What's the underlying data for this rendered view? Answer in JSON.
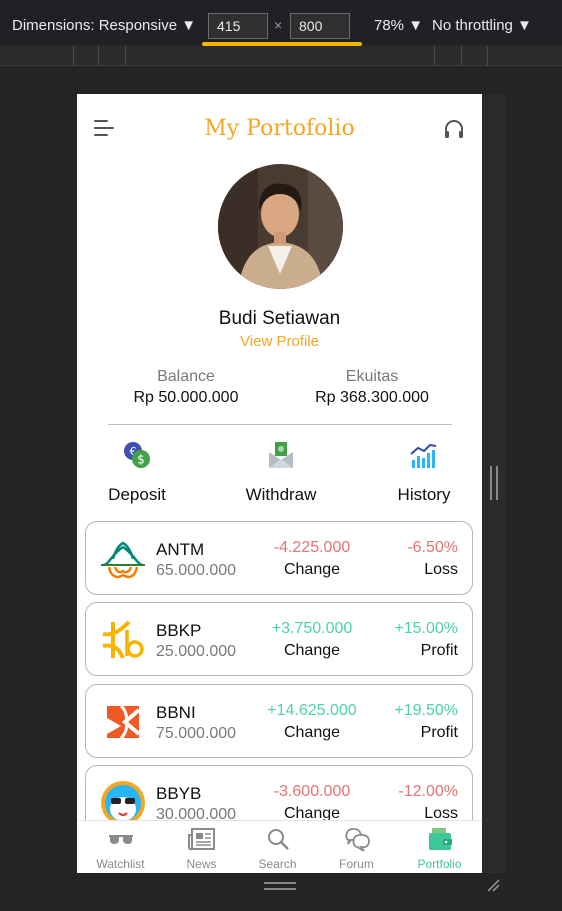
{
  "devtools": {
    "dimensions_label": "Dimensions: Responsive ▼",
    "width": "415",
    "height": "800",
    "times": "×",
    "zoom": "78% ▼",
    "throttle": "No throttling ▼"
  },
  "app": {
    "title": "My Portofolio",
    "user_name": "Budi Setiawan",
    "view_profile": "View Profile",
    "balance_label": "Balance",
    "balance_value": "Rp 50.000.000",
    "equity_label": "Ekuitas",
    "equity_value": "Rp 368.300.000",
    "actions": [
      {
        "label": "Deposit",
        "icon": "deposit-icon"
      },
      {
        "label": "Withdraw",
        "icon": "withdraw-icon"
      },
      {
        "label": "History",
        "icon": "history-chart-icon"
      }
    ],
    "holdings": [
      {
        "code": "ANTM",
        "qty": "65.000.000",
        "change": "-4.225.000",
        "change_label": "Change",
        "pct": "-6.50%",
        "status": "Loss",
        "trend": "down"
      },
      {
        "code": "BBKP",
        "qty": "25.000.000",
        "change": "+3.750.000",
        "change_label": "Change",
        "pct": "+15.00%",
        "status": "Profit",
        "trend": "up"
      },
      {
        "code": "BBNI",
        "qty": "75.000.000",
        "change": "+14.625.000",
        "change_label": "Change",
        "pct": "+19.50%",
        "status": "Profit",
        "trend": "up"
      },
      {
        "code": "BBYB",
        "qty": "30.000.000",
        "change": "-3.600.000",
        "change_label": "Change",
        "pct": "-12.00%",
        "status": "Loss",
        "trend": "down"
      }
    ],
    "nav": [
      {
        "label": "Watchlist",
        "icon": "sunglasses-icon"
      },
      {
        "label": "News",
        "icon": "newspaper-icon"
      },
      {
        "label": "Search",
        "icon": "search-icon"
      },
      {
        "label": "Forum",
        "icon": "chat-bubbles-icon"
      },
      {
        "label": "Portfolio",
        "icon": "wallet-icon",
        "active": true
      }
    ]
  },
  "colors": {
    "accent": "#f5a623",
    "loss": "#e57373",
    "profit": "#4cd3a0",
    "nav_active": "#3cc79a",
    "devtools_highlight": "#f4b400"
  }
}
